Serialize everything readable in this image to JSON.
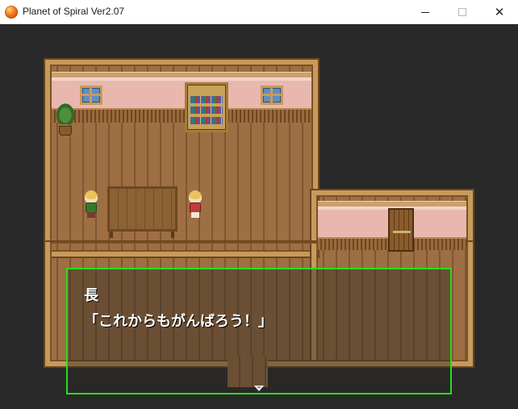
{
  "window": {
    "title": "Planet of Spiral Ver2.07",
    "controls": {
      "minimize_icon": "minimize-icon",
      "maximize_icon": "maximize-icon",
      "close_glyph": "✕"
    }
  },
  "scene": {
    "type": "rpg-interior-map",
    "room": "house-interior",
    "objects": [
      "potted-plant",
      "bookshelf",
      "windows",
      "wooden-table",
      "door",
      "two-characters"
    ]
  },
  "message": {
    "speaker": "長",
    "text": "「これからもがんばろう！」",
    "continue_icon": "continue-arrow-icon"
  },
  "colors": {
    "message_border": "#22e01f",
    "floor": "#9e6f43",
    "wall": "#e8b8ae",
    "viewport_bg": "#292929"
  }
}
